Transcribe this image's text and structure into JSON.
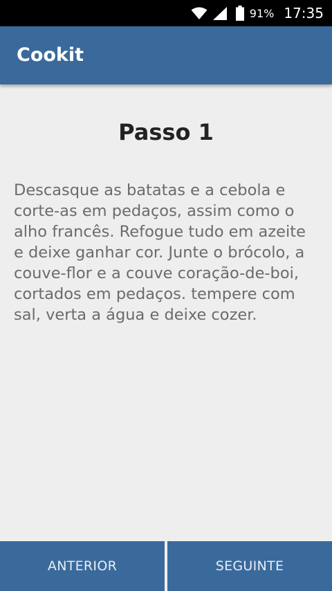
{
  "status_bar": {
    "battery_percent": "91%",
    "time": "17:35",
    "icons": [
      "wifi-icon",
      "signal-icon",
      "battery-icon"
    ]
  },
  "app_bar": {
    "title": "Cookit"
  },
  "step": {
    "title": "Passo 1",
    "instructions": "Descasque as batatas e a cebola e corte-as em pedaços, assim como o alho francês. Refogue tudo em azeite e deixe ganhar cor. Junte o brócolo, a couve-flor e a couve coração-de-boi, cortados em pedaços. tempere com sal, verta a água e deixe cozer."
  },
  "navigation": {
    "previous_label": "ANTERIOR",
    "next_label": "SEGUINTE"
  },
  "colors": {
    "primary": "#3a6a9c",
    "status_bar": "#000000",
    "background": "#eeeeee",
    "title_text": "#222222",
    "body_text": "#6b6b6b"
  }
}
